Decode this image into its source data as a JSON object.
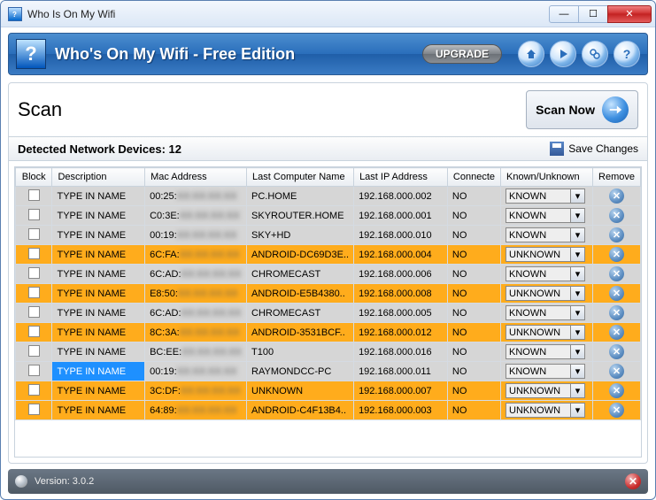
{
  "window": {
    "title": "Who Is On My Wifi"
  },
  "header": {
    "app_title": "Who's On My Wifi -  Free Edition",
    "upgrade": "UPGRADE"
  },
  "scan": {
    "title": "Scan",
    "scan_now": "Scan Now"
  },
  "detected": {
    "label": "Detected Network Devices: 12",
    "save": "Save Changes"
  },
  "columns": {
    "block": "Block",
    "description": "Description",
    "mac": "Mac Address",
    "computer": "Last Computer Name",
    "ip": "Last IP Address",
    "connected": "Connecte",
    "known": "Known/Unknown",
    "remove": "Remove"
  },
  "rows": [
    {
      "desc": "TYPE IN NAME",
      "mac_prefix": "00:25:",
      "computer": "PC.HOME",
      "ip": "192.168.000.002",
      "connected": "NO",
      "status": "KNOWN",
      "kind": "known",
      "selected": false
    },
    {
      "desc": "TYPE IN NAME",
      "mac_prefix": "C0:3E:",
      "computer": "SKYROUTER.HOME",
      "ip": "192.168.000.001",
      "connected": "NO",
      "status": "KNOWN",
      "kind": "known",
      "selected": false
    },
    {
      "desc": "TYPE IN NAME",
      "mac_prefix": "00:19:",
      "computer": "SKY+HD",
      "ip": "192.168.000.010",
      "connected": "NO",
      "status": "KNOWN",
      "kind": "known",
      "selected": false
    },
    {
      "desc": "TYPE IN NAME",
      "mac_prefix": "6C:FA:",
      "computer": "ANDROID-DC69D3E..",
      "ip": "192.168.000.004",
      "connected": "NO",
      "status": "UNKNOWN",
      "kind": "unknown",
      "selected": false
    },
    {
      "desc": "TYPE IN NAME",
      "mac_prefix": "6C:AD:",
      "computer": "CHROMECAST",
      "ip": "192.168.000.006",
      "connected": "NO",
      "status": "KNOWN",
      "kind": "known",
      "selected": false
    },
    {
      "desc": "TYPE IN NAME",
      "mac_prefix": "E8:50:",
      "computer": "ANDROID-E5B4380..",
      "ip": "192.168.000.008",
      "connected": "NO",
      "status": "UNKNOWN",
      "kind": "unknown",
      "selected": false
    },
    {
      "desc": "TYPE IN NAME",
      "mac_prefix": "6C:AD:",
      "computer": "CHROMECAST",
      "ip": "192.168.000.005",
      "connected": "NO",
      "status": "KNOWN",
      "kind": "known",
      "selected": false
    },
    {
      "desc": "TYPE IN NAME",
      "mac_prefix": "8C:3A:",
      "computer": "ANDROID-3531BCF..",
      "ip": "192.168.000.012",
      "connected": "NO",
      "status": "UNKNOWN",
      "kind": "unknown",
      "selected": false
    },
    {
      "desc": "TYPE IN NAME",
      "mac_prefix": "BC:EE:",
      "computer": "T100",
      "ip": "192.168.000.016",
      "connected": "NO",
      "status": "KNOWN",
      "kind": "known",
      "selected": false
    },
    {
      "desc": "TYPE IN NAME",
      "mac_prefix": "00:19:",
      "computer": "RAYMONDCC-PC",
      "ip": "192.168.000.011",
      "connected": "NO",
      "status": "KNOWN",
      "kind": "known",
      "selected": true
    },
    {
      "desc": "TYPE IN NAME",
      "mac_prefix": "3C:DF:",
      "computer": "UNKNOWN",
      "ip": "192.168.000.007",
      "connected": "NO",
      "status": "UNKNOWN",
      "kind": "unknown",
      "selected": false
    },
    {
      "desc": "TYPE IN NAME",
      "mac_prefix": "64:89:",
      "computer": "ANDROID-C4F13B4..",
      "ip": "192.168.000.003",
      "connected": "NO",
      "status": "UNKNOWN",
      "kind": "unknown",
      "selected": false
    }
  ],
  "footer": {
    "version": "Version: 3.0.2"
  }
}
